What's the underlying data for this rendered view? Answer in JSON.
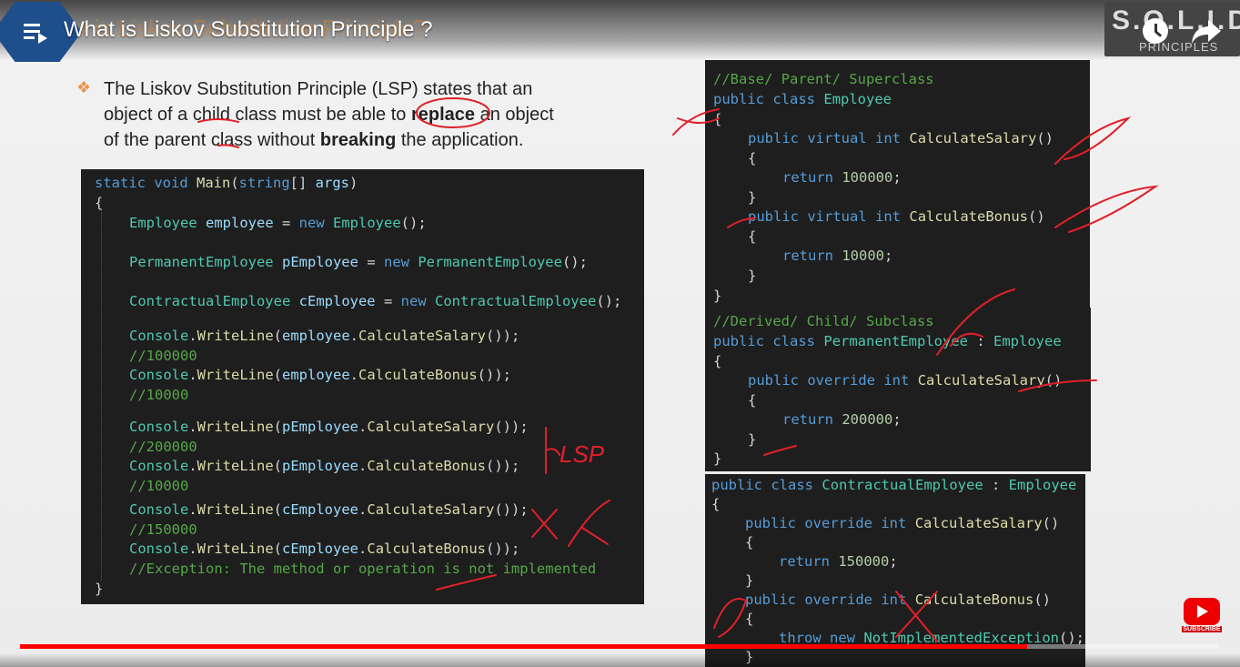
{
  "header": {
    "title": "What is Liskov Substitution Principle ?",
    "ghost_title": "What is Liskov Substitution Principle?",
    "logo_main": "S.O.L.I.D.",
    "logo_sub": "PRINCIPLES"
  },
  "bullet": {
    "marker": "❖",
    "line1_a": "The Liskov Substitution Principle (LSP) states that an",
    "line2_a": "object of a child class must be able to ",
    "line2_b": "replace",
    "line2_c": " an object",
    "line3_a": "of the parent class without ",
    "line3_b": "breaking",
    "line3_c": " the  application."
  },
  "main_code": {
    "l1": [
      "static",
      " void ",
      "Main",
      "(",
      "string",
      "[] ",
      "args",
      ")"
    ],
    "l2": "{",
    "l3": [
      "Employee",
      " ",
      "employee",
      " = ",
      "new",
      " ",
      "Employee",
      "();"
    ],
    "l4": [
      "PermanentEmployee",
      " ",
      "pEmployee",
      " = ",
      "new",
      " ",
      "PermanentEmployee",
      "();"
    ],
    "l5": [
      "ContractualEmployee",
      " ",
      "cEmployee",
      " = ",
      "new",
      " ",
      "ContractualEmployee",
      "();"
    ],
    "l6": [
      "Console",
      ".",
      "WriteLine",
      "(",
      "employee",
      ".",
      "CalculateSalary",
      "());"
    ],
    "l7": "//100000",
    "l8": [
      "Console",
      ".",
      "WriteLine",
      "(",
      "employee",
      ".",
      "CalculateBonus",
      "());"
    ],
    "l9": "//10000",
    "l10": [
      "Console",
      ".",
      "WriteLine",
      "(",
      "pEmployee",
      ".",
      "CalculateSalary",
      "());"
    ],
    "l11": "//200000",
    "l12": [
      "Console",
      ".",
      "WriteLine",
      "(",
      "pEmployee",
      ".",
      "CalculateBonus",
      "());"
    ],
    "l13": "//10000",
    "l14": [
      "Console",
      ".",
      "WriteLine",
      "(",
      "cEmployee",
      ".",
      "CalculateSalary",
      "());"
    ],
    "l15": "//150000",
    "l16": [
      "Console",
      ".",
      "WriteLine",
      "(",
      "cEmployee",
      ".",
      "CalculateBonus",
      "());"
    ],
    "l17": "//Exception: The method or operation is not implemented",
    "l18": "}"
  },
  "employee_code": {
    "l1": "//Base/ Parent/ Superclass",
    "l2": [
      "public",
      " ",
      "class",
      " ",
      "Employee"
    ],
    "l3": "{",
    "l4": [
      "public",
      " ",
      "virtual",
      " ",
      "int",
      " ",
      "CalculateSalary",
      "()"
    ],
    "l5": "{",
    "l6": [
      "return",
      " ",
      "100000",
      ";"
    ],
    "l7": "}",
    "l8": [
      "public",
      " ",
      "virtual",
      " ",
      "int",
      " ",
      "CalculateBonus",
      "()"
    ],
    "l9": "{",
    "l10": [
      "return",
      " ",
      "10000",
      ";"
    ],
    "l11": "}",
    "l12": "}"
  },
  "permanent_code": {
    "l1": "//Derived/ Child/ Subclass",
    "l2": [
      "public",
      " ",
      "class",
      " ",
      "PermanentEmployee",
      " : ",
      "Employee"
    ],
    "l3": "{",
    "l4": [
      "public",
      " ",
      "override",
      " ",
      "int",
      " ",
      "CalculateSalary",
      "()"
    ],
    "l5": "{",
    "l6": [
      "return",
      " ",
      "200000",
      ";"
    ],
    "l7": "}",
    "l8": "}"
  },
  "contractual_code": {
    "l1": [
      "public",
      " ",
      "class",
      " ",
      "ContractualEmployee",
      " : ",
      "Employee"
    ],
    "l2": "{",
    "l3": [
      "public",
      " ",
      "override",
      " ",
      "int",
      " ",
      "CalculateSalary",
      "()"
    ],
    "l4": "{",
    "l5": [
      "return",
      " ",
      "150000",
      ";"
    ],
    "l6": "}",
    "l7": [
      "public",
      " ",
      "override",
      " ",
      "int",
      " ",
      "CalculateBonus",
      "()"
    ],
    "l8": "{",
    "l9": [
      "throw",
      " ",
      "new",
      " ",
      "NotImplementedException",
      "();"
    ],
    "l10": "}"
  },
  "annotation_text": "LSP",
  "player": {
    "progress": 0.84,
    "subscribe_label": "SUBSCRIBE"
  },
  "colors": {
    "accent_red": "#e0202a",
    "keyword": "#569cd6",
    "type": "#4ec9b0",
    "method": "#dcdcaa",
    "comment": "#57a64a",
    "number": "#b5cea8",
    "code_bg": "#1e1e1e"
  }
}
